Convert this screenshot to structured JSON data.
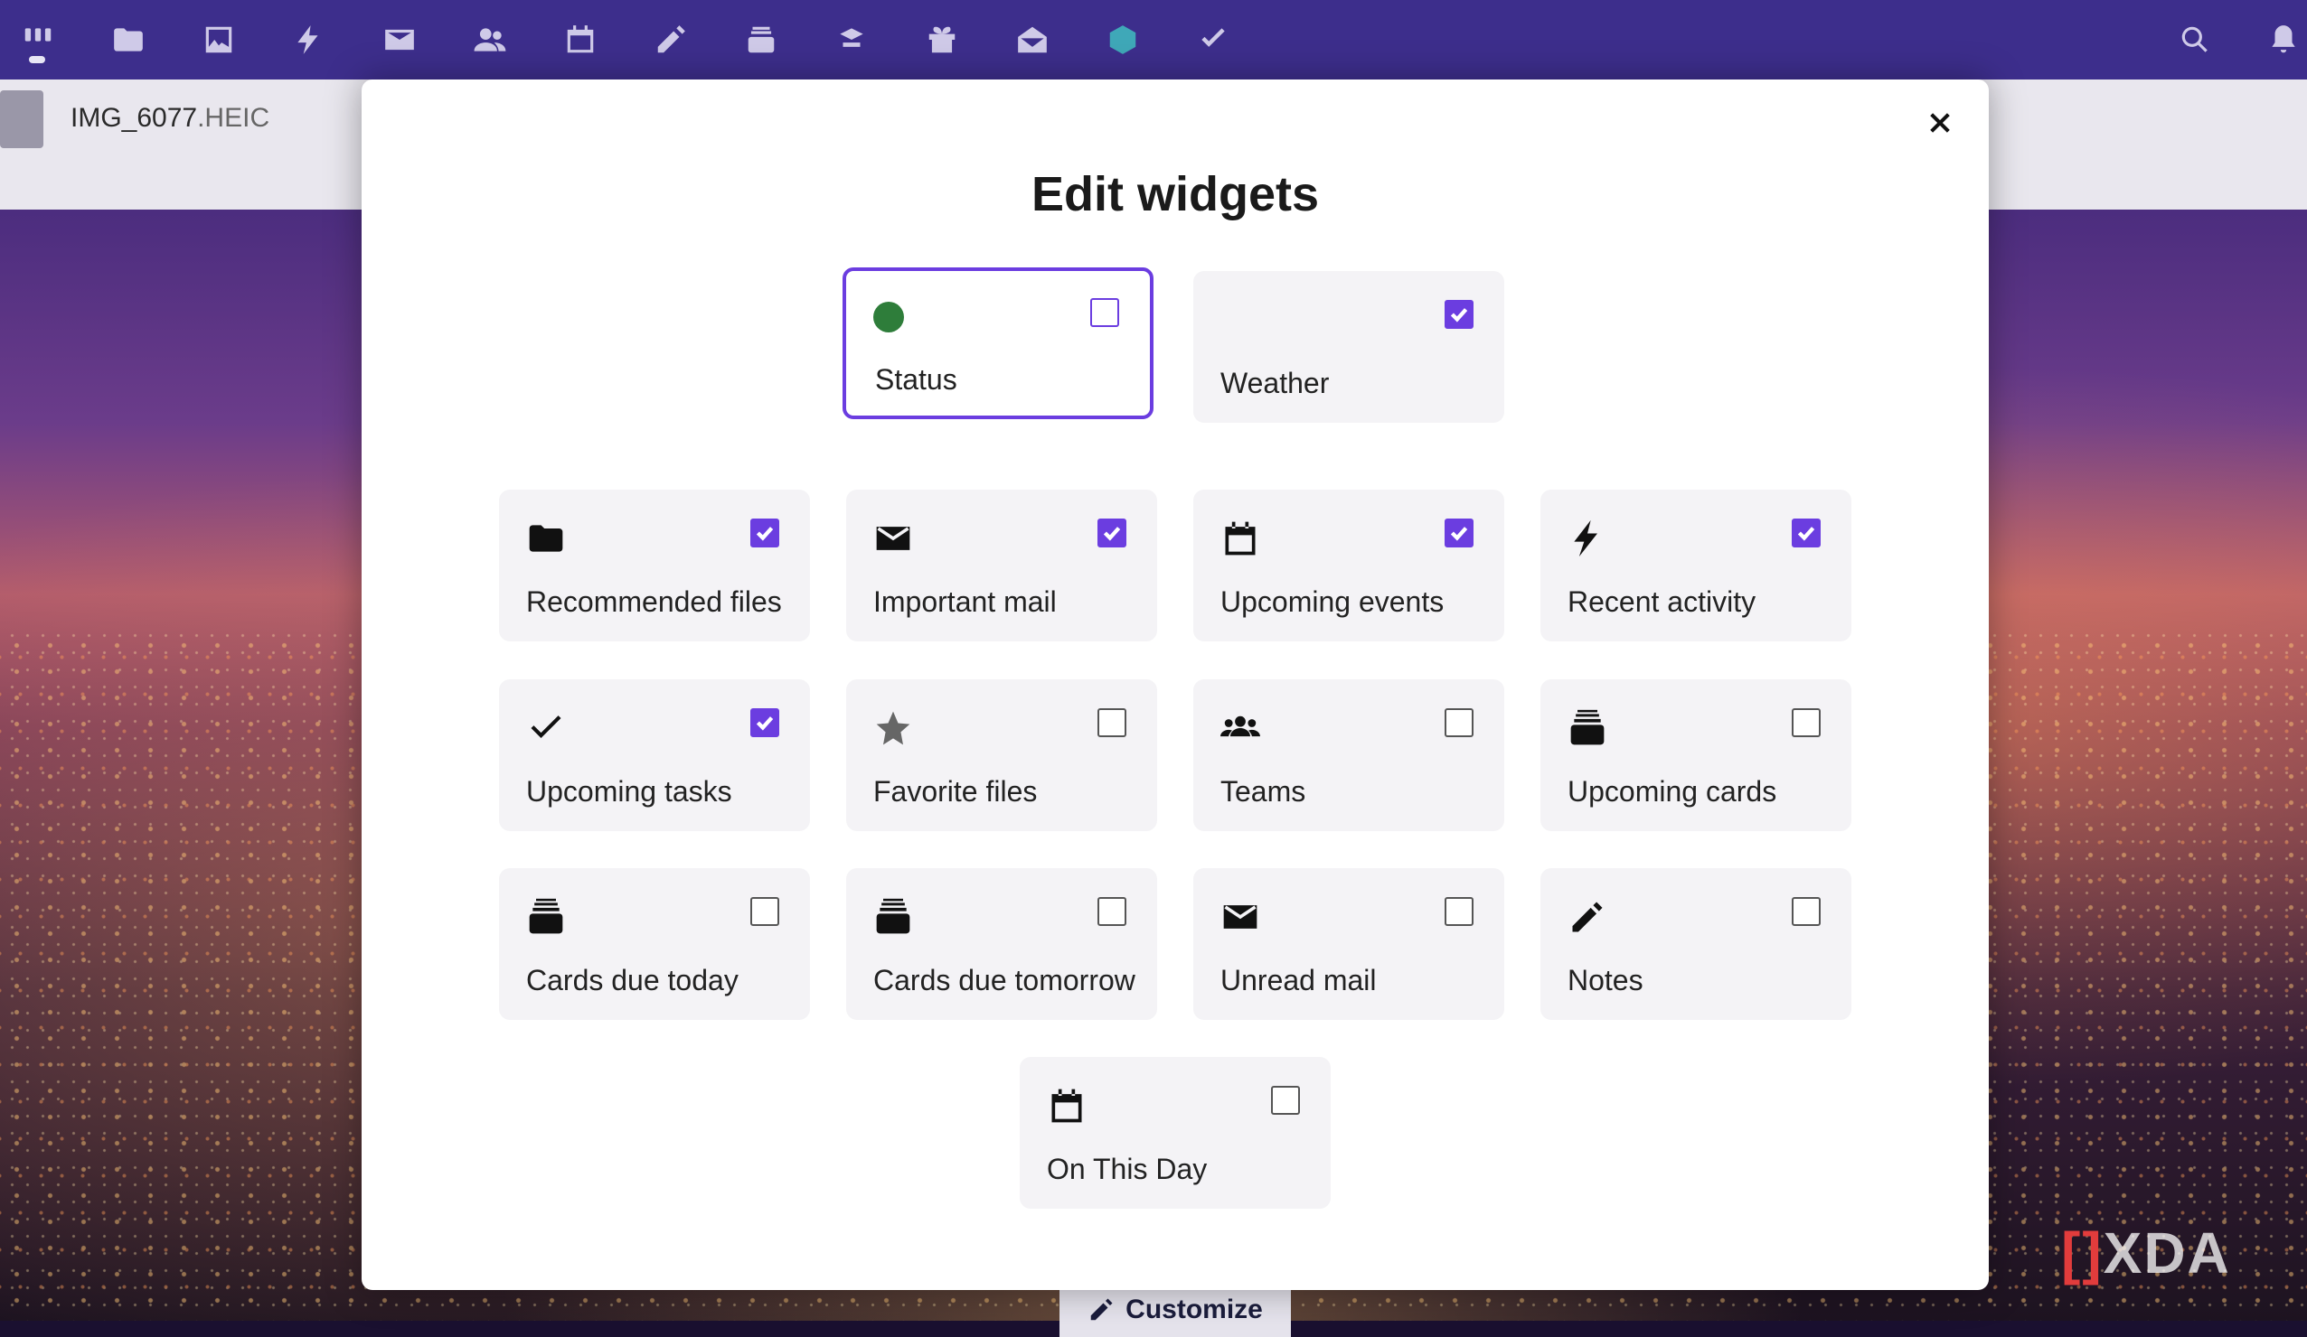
{
  "file": {
    "name": "IMG_6077",
    "ext": ".HEIC"
  },
  "modal": {
    "title": "Edit widgets",
    "close_icon": "close-icon"
  },
  "customize_label": "Customize",
  "watermark": "XDA",
  "colors": {
    "accent": "#6b3de0",
    "topbar": "#3d2e8c",
    "status_green": "#2e7d3a"
  },
  "top_apps": [
    {
      "name": "dashboard-icon"
    },
    {
      "name": "files-icon"
    },
    {
      "name": "photos-icon"
    },
    {
      "name": "activity-icon"
    },
    {
      "name": "mail-icon"
    },
    {
      "name": "contacts-icon"
    },
    {
      "name": "calendar-icon"
    },
    {
      "name": "notes-icon"
    },
    {
      "name": "deck-icon"
    },
    {
      "name": "tables-icon"
    },
    {
      "name": "gift-icon"
    },
    {
      "name": "mail-open-icon"
    },
    {
      "name": "cube-icon"
    },
    {
      "name": "tasks-icon"
    }
  ],
  "top_right": [
    "search-icon",
    "notifications-icon"
  ],
  "widgets": [
    {
      "id": "status",
      "label": "Status",
      "icon": "status-dot-icon",
      "checked": false,
      "focused": true
    },
    {
      "id": "weather",
      "label": "Weather",
      "icon": "",
      "checked": true
    },
    {
      "id": "recommended-files",
      "label": "Recommended files",
      "icon": "folder-icon",
      "checked": true
    },
    {
      "id": "important-mail",
      "label": "Important mail",
      "icon": "mail-icon",
      "checked": true
    },
    {
      "id": "upcoming-events",
      "label": "Upcoming events",
      "icon": "calendar-icon",
      "checked": true
    },
    {
      "id": "recent-activity",
      "label": "Recent activity",
      "icon": "lightning-icon",
      "checked": true
    },
    {
      "id": "upcoming-tasks",
      "label": "Upcoming tasks",
      "icon": "checkmark-icon",
      "checked": true
    },
    {
      "id": "favorite-files",
      "label": "Favorite files",
      "icon": "star-icon",
      "checked": false
    },
    {
      "id": "teams",
      "label": "Teams",
      "icon": "teams-icon",
      "checked": false
    },
    {
      "id": "upcoming-cards",
      "label": "Upcoming cards",
      "icon": "deck-cards-icon",
      "checked": false
    },
    {
      "id": "cards-due-today",
      "label": "Cards due today",
      "icon": "deck-cards-icon",
      "checked": false
    },
    {
      "id": "cards-due-tomorrow",
      "label": "Cards due tomorrow",
      "icon": "deck-cards-icon",
      "checked": false
    },
    {
      "id": "unread-mail",
      "label": "Unread mail",
      "icon": "mail-icon",
      "checked": false
    },
    {
      "id": "notes",
      "label": "Notes",
      "icon": "pencil-icon",
      "checked": false
    },
    {
      "id": "on-this-day",
      "label": "On This Day",
      "icon": "calendar-icon",
      "checked": false
    }
  ]
}
